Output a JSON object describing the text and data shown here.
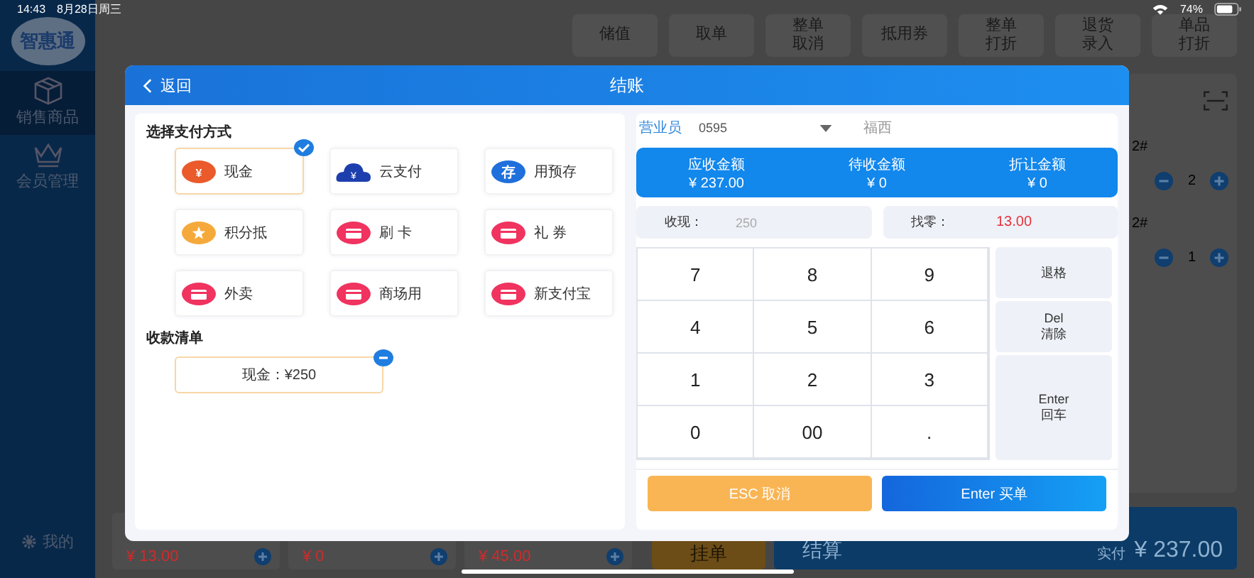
{
  "status_bar": {
    "time": "14:43",
    "date": "8月28日周三",
    "battery": "74%"
  },
  "sidebar": {
    "logo": "智惠通",
    "items": [
      {
        "label": "销售商品",
        "selected": true
      },
      {
        "label": "会员管理",
        "selected": false
      }
    ],
    "footer": "我的"
  },
  "toolbar": [
    "储值",
    "取单",
    "整单取消",
    "抵用券",
    "整单打折",
    "退货录入",
    "单品打折"
  ],
  "cart": {
    "items": [
      {
        "name": "2#",
        "qty": "2"
      },
      {
        "name": "2#",
        "qty": "1"
      }
    ]
  },
  "bottom_bar": {
    "products": [
      {
        "price": "¥ 13.00"
      },
      {
        "price": "¥ 0"
      },
      {
        "price": "¥ 45.00"
      }
    ],
    "hold": "挂单",
    "checkout": "结算",
    "paid_label": "实付",
    "paid": "¥ 237.00"
  },
  "dialog": {
    "back": "返回",
    "title": "结账",
    "methods_title": "选择支付方式",
    "methods": [
      {
        "label": "现金",
        "kind": "cash",
        "badge_text": "¥",
        "selected": true
      },
      {
        "label": "云支付",
        "kind": "cloud",
        "badge_text": "¥",
        "selected": false
      },
      {
        "label": "用预存",
        "kind": "deposit",
        "badge_text": "存",
        "selected": false
      },
      {
        "label": "积分抵",
        "kind": "points",
        "selected": false
      },
      {
        "label": "刷 卡",
        "kind": "card",
        "selected": false
      },
      {
        "label": "礼 券",
        "kind": "card",
        "selected": false
      },
      {
        "label": "外卖",
        "kind": "card",
        "selected": false
      },
      {
        "label": "商场用",
        "kind": "card",
        "selected": false
      },
      {
        "label": "新支付宝",
        "kind": "card",
        "selected": false
      }
    ],
    "receipts_title": "收款清单",
    "receipts": [
      {
        "label": "现金：¥250"
      }
    ],
    "clerk_label": "营业员",
    "clerk_value": "0595",
    "clerk_name": "福西",
    "summary": [
      {
        "label": "应收金额",
        "value": "¥ 237.00"
      },
      {
        "label": "待收金额",
        "value": "¥ 0"
      },
      {
        "label": "折让金额",
        "value": "¥ 0"
      }
    ],
    "received_label": "收现：",
    "received_value": "250",
    "change_label": "找零：",
    "change_value": "13.00",
    "keys": [
      "7",
      "8",
      "9",
      "4",
      "5",
      "6",
      "1",
      "2",
      "3",
      "0",
      "00",
      "."
    ],
    "side_keys": [
      "退格",
      "Del\n清除",
      "Enter\n回车"
    ],
    "cancel": "ESC 取消",
    "confirm": "Enter 买单"
  }
}
